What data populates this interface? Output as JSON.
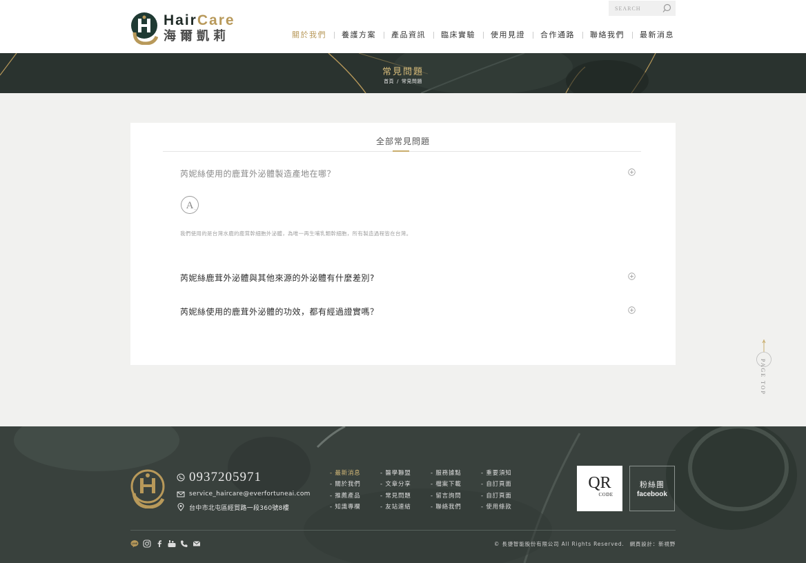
{
  "brand": {
    "name_en_1": "Hair",
    "name_en_2": "Care",
    "name_zh": "海爾凱莉"
  },
  "search": {
    "placeholder": "SEARCH"
  },
  "nav": {
    "items": [
      "關於我們",
      "養護方案",
      "產品資訊",
      "臨床實驗",
      "使用見證",
      "合作通路",
      "聯絡我們",
      "最新消息"
    ],
    "active_index": 0
  },
  "banner": {
    "title": "常見問題",
    "breadcrumb_home": "首頁",
    "breadcrumb_sep": "/",
    "breadcrumb_current": "常見問題"
  },
  "faq": {
    "section_title": "全部常見問題",
    "items": [
      {
        "question": "芮妮絲使用的鹿茸外泌體製造產地在哪？",
        "open": true,
        "answer": "我們使用的是台灣水鹿的鹿茸幹細胞外泌體，為唯一再生哺乳類幹細胞，所有製造過程皆在台灣。"
      },
      {
        "question": "芮妮絲鹿茸外泌體與其他來源的外泌體有什麼差別?",
        "open": false
      },
      {
        "question": "芮妮絲使用的鹿茸外泌體的功效，都有經過證實嗎？",
        "open": false
      }
    ]
  },
  "page_top": {
    "label": "PAGE TOP"
  },
  "footer": {
    "phone": "0937205971",
    "email": "service_haircare@everfortuneai.com",
    "address": "台中市北屯區經貿路一段360號8樓",
    "link_columns": [
      [
        "最新消息",
        "關於我們",
        "推薦產品",
        "知識專欄"
      ],
      [
        "醫學聯盟",
        "文章分享",
        "常見問題",
        "友站連結"
      ],
      [
        "服務據點",
        "檔案下載",
        "留言詢問",
        "聯絡我們"
      ],
      [
        "重要須知",
        "自訂頁面",
        "自訂頁面",
        "使用條款"
      ]
    ],
    "link_prefix": "- ",
    "qr": {
      "big": "QR",
      "small": "CODE"
    },
    "fb": {
      "zh": "粉絲團",
      "en": "facebook"
    },
    "social_icons": [
      "line-icon",
      "instagram-icon",
      "facebook-icon",
      "youtube-icon",
      "phone-icon",
      "mail-icon"
    ],
    "copyright": "© 長捷智能股份有限公司 All Rights Reserved.",
    "design": "網頁設計：新視野"
  },
  "colors": {
    "gold": "#b8995a",
    "dark_green": "#2a332f",
    "footer_bg": "#39413d"
  }
}
